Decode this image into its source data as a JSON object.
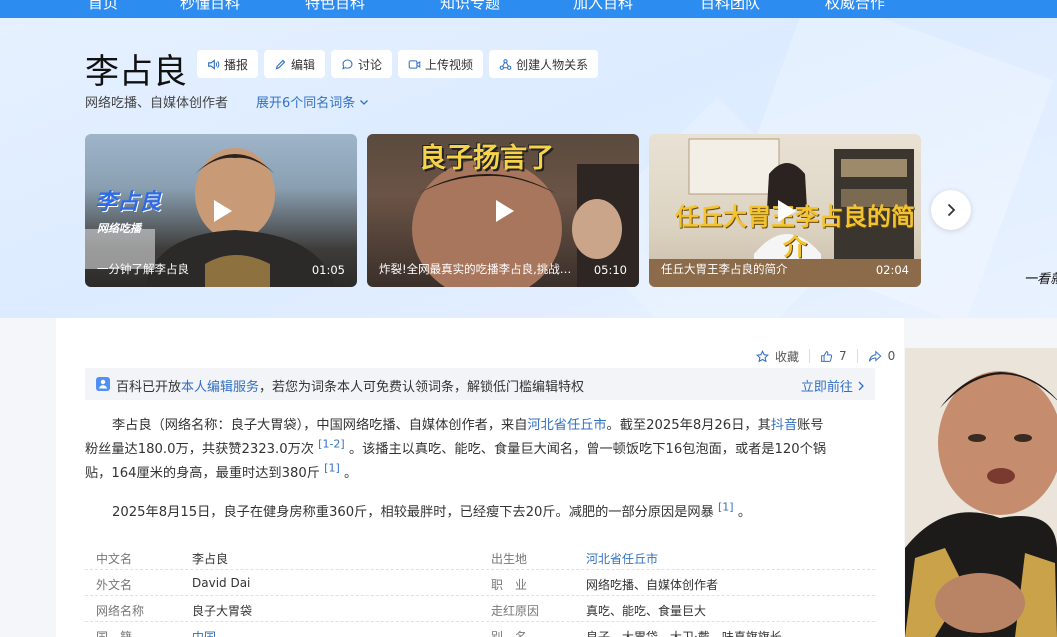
{
  "topnav": {
    "items": [
      "首页",
      "秒懂百科",
      "特色百科",
      "知识专题",
      "加入百科",
      "百科团队",
      "权威合作"
    ]
  },
  "title": "李占良",
  "actions": [
    {
      "label": "播报",
      "icon": "speaker-icon"
    },
    {
      "label": "编辑",
      "icon": "pencil-icon"
    },
    {
      "label": "讨论",
      "icon": "chat-icon"
    },
    {
      "label": "上传视频",
      "icon": "video-upload-icon"
    },
    {
      "label": "创建人物关系",
      "icon": "relation-icon"
    }
  ],
  "subtitle": "网络吃播、自媒体创作者",
  "expand_label": "展开6个同名词条",
  "videos": [
    {
      "title": "一分钟了解李占良",
      "duration": "01:05",
      "caption": "李占良",
      "caption2": "网络吃播"
    },
    {
      "title": "炸裂!全网最真实的吃播李占良,挑战…",
      "duration": "05:10",
      "caption": "良子扬言了"
    },
    {
      "title": "任丘大胃王李占良的简介",
      "duration": "02:04",
      "caption": "任丘大胃王李占良的简介"
    }
  ],
  "peek_text": "一看就",
  "meta": {
    "collect_label": "收藏",
    "likes": "7",
    "shares": "0"
  },
  "notice": {
    "prefix": "百科已开放",
    "link": "本人编辑服务",
    "suffix": "，若您为词条本人可免费认领词条，解锁低门槛编辑特权",
    "go": "立即前往"
  },
  "para1": {
    "a1": "李占良（网络名称：良子大胃袋），中国网络吃播、自媒体创作者，来自",
    "link1": "河北省任丘市",
    "a2": "。截至2025年8月26日，其",
    "link2": "抖音",
    "a3": "账号",
    "b1": "粉丝量达180.0万，共获赞2323.0万次",
    "ref1": "[1-2]",
    "b2": "。该播主以真吃、能吃、食量巨大闻名，曾一顿饭吃下16包泡面，或者是120个锅",
    "c1": "贴，164厘米的身高，最重时达到380斤",
    "ref2": "[1]",
    "c2": "。"
  },
  "para2": {
    "text": "2025年8月15日，良子在健身房称重360斤，相较最胖时，已经瘦下去20斤。减肥的一部分原因是网暴",
    "ref": "[1]",
    "end": "。"
  },
  "info_rows": [
    {
      "k1": "中文名",
      "v1": "李占良",
      "k2": "出生地",
      "v2": "河北省任丘市",
      "link1": false,
      "link2": true
    },
    {
      "k1": "外文名",
      "v1": "David Dai",
      "k2": "职　业",
      "v2": "网络吃播、自媒体创作者",
      "link1": false,
      "link2": false
    },
    {
      "k1": "网络名称",
      "v1": "良子大胃袋",
      "k2": "走红原因",
      "v2": "真吃、能吃、食量巨大",
      "link1": false,
      "link2": false
    },
    {
      "k1": "国　籍",
      "v1": "中国",
      "k2": "别　名",
      "v2": "良子、大胃袋、大卫·戴、味真旗旗长",
      "link1": true,
      "link2": false
    }
  ],
  "colors": {
    "nav": "#2d8cf0",
    "link": "#3371c4",
    "accent_icon": "#4f8ff7"
  }
}
